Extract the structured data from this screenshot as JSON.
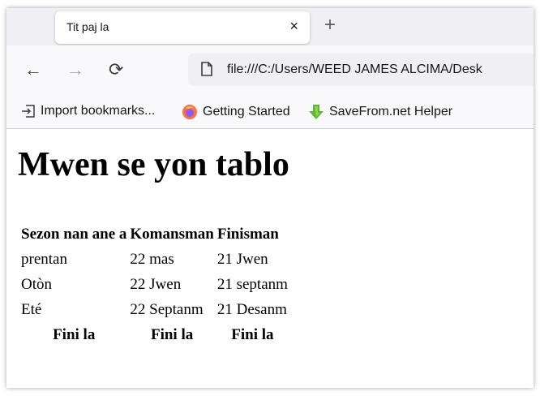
{
  "browser": {
    "tab_title": "Tit paj la",
    "tab_close": "×",
    "new_tab": "+",
    "nav": {
      "back": "←",
      "forward": "→",
      "reload": "⟳"
    },
    "url": "file:///C:/Users/WEED JAMES ALCIMA/Desk",
    "bookmarks": [
      {
        "label": "Import bookmarks...",
        "icon": "import-icon"
      },
      {
        "label": "Getting Started",
        "icon": "firefox-icon"
      },
      {
        "label": "SaveFrom.net Helper",
        "icon": "download-arrow-icon"
      }
    ]
  },
  "page": {
    "heading": "Mwen se yon tablo",
    "table": {
      "headers": [
        "Sezon nan ane a",
        "Komansman",
        "Finisman"
      ],
      "rows": [
        [
          "prentan",
          "22 mas",
          "21 Jwen"
        ],
        [
          "Otòn",
          "22 Jwen",
          "21 septanm"
        ],
        [
          "Eté",
          "22 Septanm",
          "21 Desanm"
        ]
      ],
      "footer": [
        "Fini la",
        "Fini la",
        "Fini la"
      ]
    }
  },
  "colors": {
    "tabstrip_bg": "#f0f0f4",
    "toolbar_bg": "#f9f9fb",
    "firefox_orange": "#ff7139",
    "savefrom_green": "#5cb82e"
  }
}
